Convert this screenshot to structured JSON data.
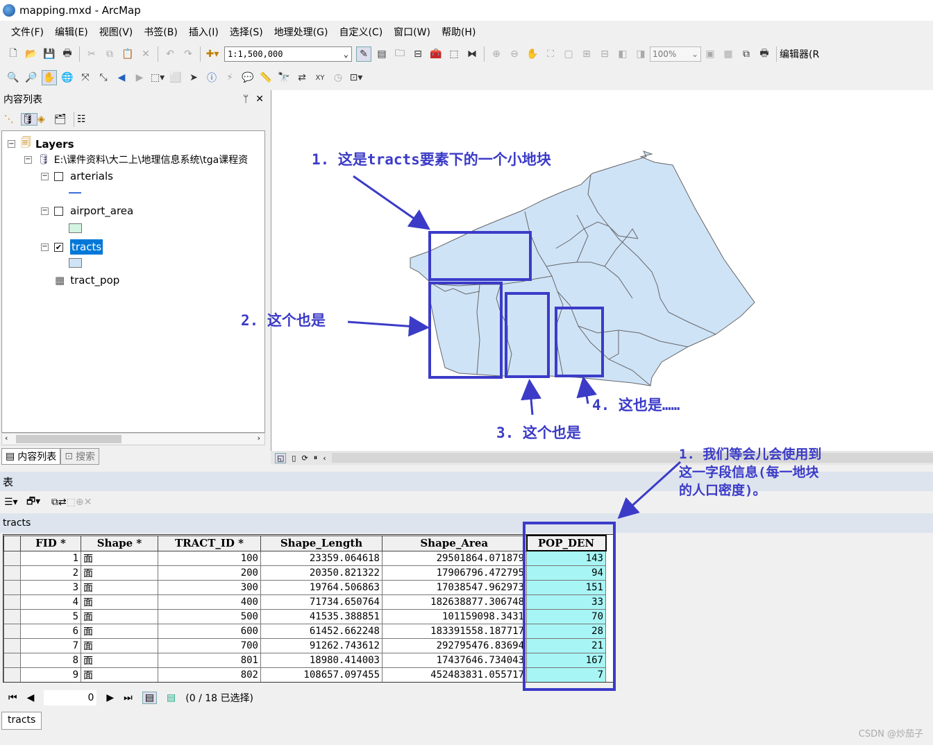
{
  "window": {
    "title": "mapping.mxd - ArcMap"
  },
  "menu": [
    "文件(F)",
    "编辑(E)",
    "视图(V)",
    "书签(B)",
    "插入(I)",
    "选择(S)",
    "地理处理(G)",
    "自定义(C)",
    "窗口(W)",
    "帮助(H)"
  ],
  "toolbar": {
    "scale": "1:1,500,000",
    "zoom": "100%",
    "editor_label": "编辑器(R"
  },
  "toc": {
    "title": "内容列表",
    "pin": "ᛘ",
    "close": "✕",
    "root": "Layers",
    "source": "E:\\课件资料\\大二上\\地理信息系统\\tga课程资",
    "layers": [
      "arterials",
      "airport_area",
      "tracts"
    ],
    "table": "tract_pop",
    "tabs": [
      "内容列表",
      "搜索"
    ]
  },
  "colors": {
    "tracts_fill": "#cfe3f7",
    "airport_fill": "#d2f4e0",
    "arterial_line": "#3a6fd8",
    "annotation": "#3b3bc8",
    "highlight": "#a8f5f5"
  },
  "table_panel": {
    "title": "表",
    "layer": "tracts",
    "status": "(0 / 18 已选择)",
    "record": "0",
    "bottom_tab": "tracts"
  },
  "columns": [
    "FID *",
    "Shape *",
    "TRACT_ID *",
    "Shape_Length",
    "Shape_Area",
    "POP_DEN"
  ],
  "rows": [
    [
      "1",
      "面",
      "100",
      "23359.064618",
      "29501864.071879",
      "143"
    ],
    [
      "2",
      "面",
      "200",
      "20350.821322",
      "17906796.472795",
      "94"
    ],
    [
      "3",
      "面",
      "300",
      "19764.506863",
      "17038547.962973",
      "151"
    ],
    [
      "4",
      "面",
      "400",
      "71734.650764",
      "182638877.306748",
      "33"
    ],
    [
      "5",
      "面",
      "500",
      "41535.388851",
      "101159098.3431",
      "70"
    ],
    [
      "6",
      "面",
      "600",
      "61452.662248",
      "183391558.187717",
      "28"
    ],
    [
      "7",
      "面",
      "700",
      "91262.743612",
      "292795476.83694",
      "21"
    ],
    [
      "8",
      "面",
      "801",
      "18980.414003",
      "17437646.734043",
      "167"
    ],
    [
      "9",
      "面",
      "802",
      "108657.097455",
      "452483831.055717",
      "7"
    ]
  ],
  "annotations": {
    "a1": "1. 这是tracts要素下的一个小地块",
    "a2": "2. 这个也是",
    "a3": "3. 这个也是",
    "a4": "4. 这也是……",
    "note_line1": "1. 我们等会儿会使用到",
    "note_line2": "这一字段信息(每一地块",
    "note_line3": "的人口密度)。"
  },
  "watermark": "CSDN @炒茄子"
}
